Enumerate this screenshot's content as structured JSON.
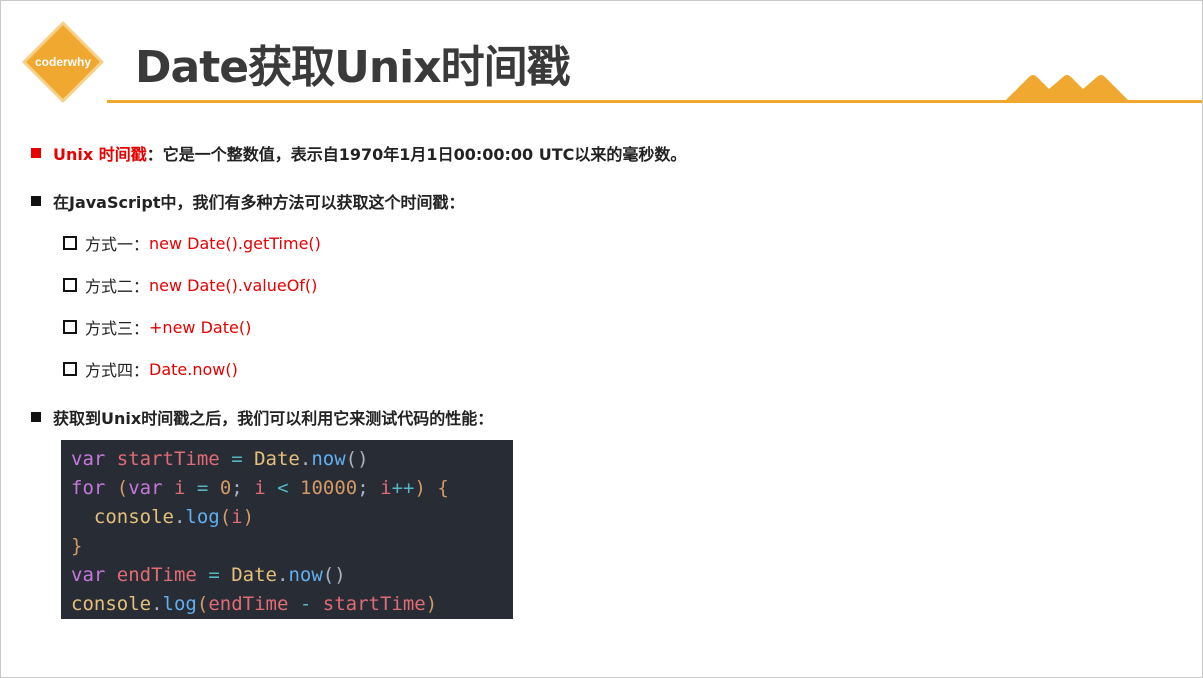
{
  "logo": {
    "text": "coderwhy"
  },
  "title": "Date获取Unix时间戳",
  "bullet1": {
    "term": "Unix 时间戳",
    "text": "：它是一个整数值，表示自1970年1月1日00:00:00 UTC以来的毫秒数。"
  },
  "bullet2": {
    "text": "在JavaScript中，我们有多种方法可以获取这个时间戳："
  },
  "methods": [
    {
      "label": "方式一：",
      "code": "new Date().getTime()"
    },
    {
      "label": "方式二：",
      "code": "new Date().valueOf()"
    },
    {
      "label": "方式三：",
      "code": "+new Date()"
    },
    {
      "label": "方式四：",
      "code": "Date.now()"
    }
  ],
  "bullet3": {
    "text": "获取到Unix时间戳之后，我们可以利用它来测试代码的性能："
  },
  "code": {
    "l1": {
      "kw": "var",
      "v": "startTime",
      "op": "=",
      "obj": "Date",
      "dot": ".",
      "fn": "now",
      "paren": "()"
    },
    "l2": {
      "kw": "for",
      "open": "(",
      "kw2": "var",
      "v": "i",
      "op": "=",
      "num0": "0",
      "semi": ";",
      "v2": "i",
      "lt": "<",
      "num": "10000",
      "semi2": ";",
      "v3": "i",
      "inc": "++",
      "close": ")",
      "brace": "{"
    },
    "l3": {
      "obj": "console",
      "dot": ".",
      "fn": "log",
      "open": "(",
      "v": "i",
      "close": ")"
    },
    "l4": {
      "brace": "}"
    },
    "l5": {
      "kw": "var",
      "v": "endTime",
      "op": "=",
      "obj": "Date",
      "dot": ".",
      "fn": "now",
      "paren": "()"
    },
    "l6": {
      "obj": "console",
      "dot": ".",
      "fn": "log",
      "open": "(",
      "v": "endTime",
      "op": "-",
      "v2": "startTime",
      "close": ")"
    }
  },
  "colors": {
    "accent": "#f0a830",
    "red": "#e60000",
    "codeBg": "#282c34"
  }
}
